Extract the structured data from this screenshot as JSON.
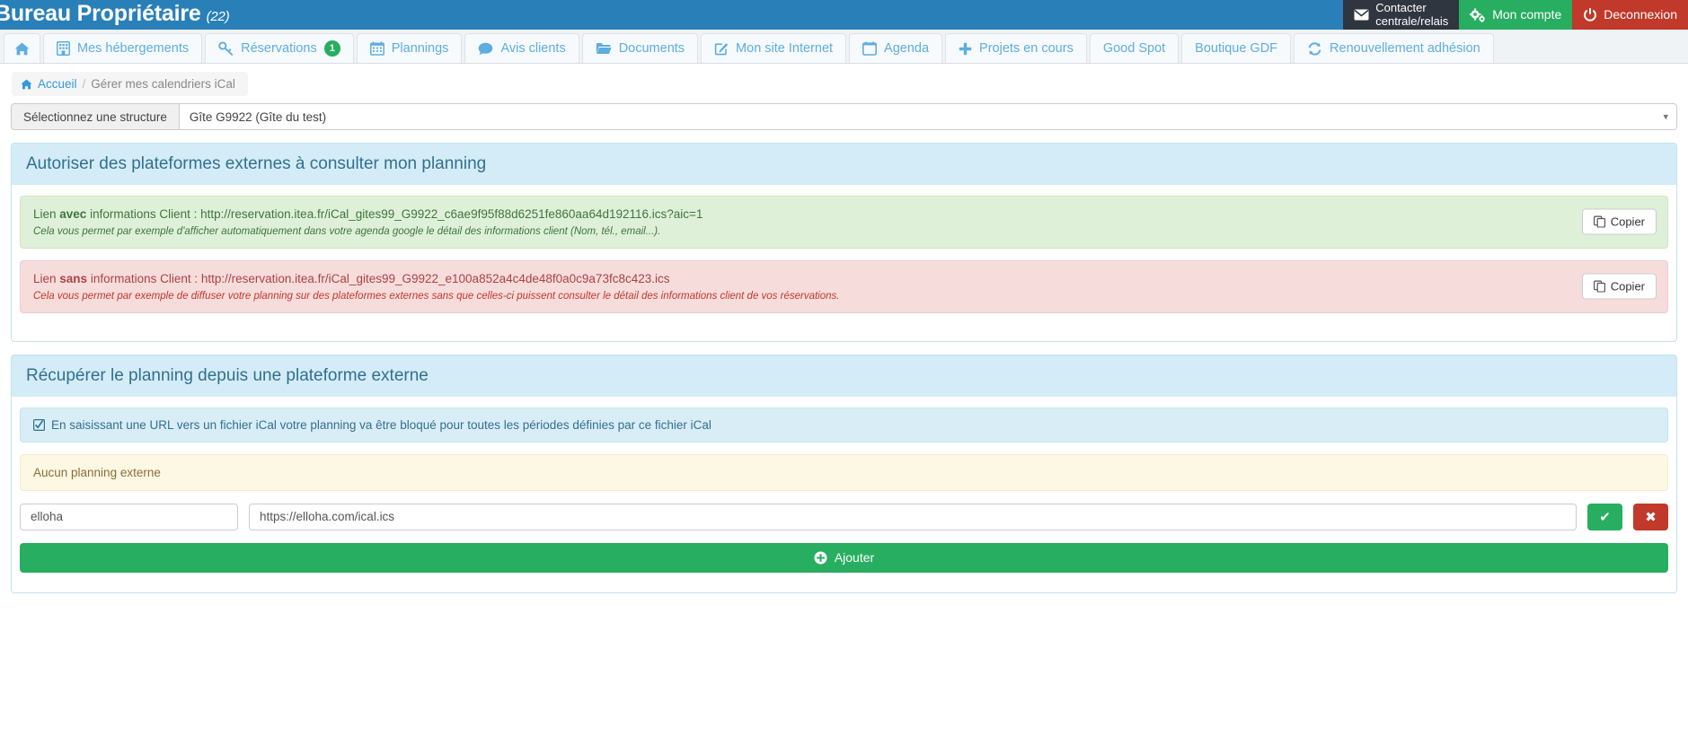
{
  "header": {
    "brand_title": "Bureau Propriétaire",
    "brand_count": "(22)",
    "contact_line1": "Contacter",
    "contact_line2": "centrale/relais",
    "account_label": "Mon compte",
    "logout_label": "Deconnexion",
    "brand_color": "#2980b9",
    "contact_color": "#2f3640",
    "account_color": "#27ae60",
    "logout_color": "#c0392b"
  },
  "nav": {
    "tabs": [
      {
        "label": "",
        "icon": "home-icon",
        "badge": ""
      },
      {
        "label": "Mes hébergements",
        "icon": "building-icon",
        "badge": ""
      },
      {
        "label": "Réservations",
        "icon": "key-icon",
        "badge": "1"
      },
      {
        "label": "Plannings",
        "icon": "calendar-grid-icon",
        "badge": ""
      },
      {
        "label": "Avis clients",
        "icon": "comment-icon",
        "badge": ""
      },
      {
        "label": "Documents",
        "icon": "folder-icon",
        "badge": ""
      },
      {
        "label": "Mon site Internet",
        "icon": "pencil-square-icon",
        "badge": ""
      },
      {
        "label": "Agenda",
        "icon": "calendar-icon",
        "badge": ""
      },
      {
        "label": "Projets en cours",
        "icon": "plus-icon",
        "badge": ""
      },
      {
        "label": "Good Spot",
        "icon": "",
        "badge": ""
      },
      {
        "label": "Boutique GDF",
        "icon": "",
        "badge": ""
      },
      {
        "label": "Renouvellement adhésion",
        "icon": "refresh-icon",
        "badge": ""
      }
    ]
  },
  "breadcrumb": {
    "home": "Accueil",
    "separator": "/",
    "current": "Gérer mes calendriers iCal"
  },
  "structure_select": {
    "label": "Sélectionnez une structure",
    "value": "Gîte G9922 (Gîte du test)",
    "caret": "▾"
  },
  "panel_export": {
    "title": "Autoriser des plateformes externes à consulter mon planning",
    "alerts": [
      {
        "prefix": "Lien ",
        "strong": "avec",
        "suffix": " informations Client : http://reservation.itea.fr/iCal_gites99_G9922_c6ae9f95f88d6251fe860aa64d192116.ics?aic=1",
        "note": "Cela vous permet par exemple d'afficher automatiquement dans votre agenda google le détail des informations client (Nom, tél., email...).",
        "copy_label": "Copier",
        "type": "success"
      },
      {
        "prefix": "Lien ",
        "strong": "sans",
        "suffix": " informations Client : http://reservation.itea.fr/iCal_gites99_G9922_e100a852a4c4de48f0a0c9a73fc8c423.ics",
        "note": "Cela vous permet par exemple de diffuser votre planning sur des plateformes externes sans que celles-ci puissent consulter le détail des informations client de vos réservations.",
        "copy_label": "Copier",
        "type": "danger"
      }
    ]
  },
  "panel_import": {
    "title": "Récupérer le planning depuis une plateforme externe",
    "info_icon": "checkbox-checked-icon",
    "info_text": "En saisissant une URL vers un fichier iCal votre planning va être bloqué pour toutes les périodes définies par ce fichier iCal",
    "empty_text": "Aucun planning externe",
    "form": {
      "name_value": "elloha",
      "name_placeholder": "",
      "url_value": "https://elloha.com/ical.ics",
      "url_placeholder": "",
      "confirm_glyph": "✔",
      "cancel_glyph": "✖",
      "add_label": "Ajouter",
      "add_icon": "plus-circle-icon"
    }
  }
}
